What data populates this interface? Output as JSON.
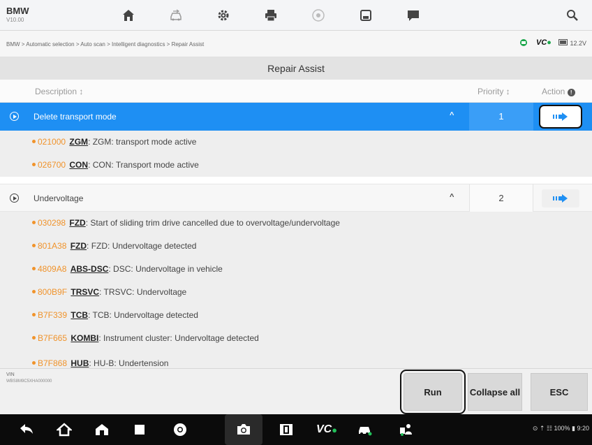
{
  "app": {
    "make": "BMW",
    "version": "V10.00"
  },
  "breadcrumb": "BMW > Automatic selection > Auto scan > Intelligent diagnostics > Repair Assist",
  "status": {
    "vc_label": "VC",
    "battery": "12.2V"
  },
  "title": "Repair Assist",
  "table": {
    "columns": {
      "description": "Description ↕",
      "priority": "Priority ↕",
      "action": "Action"
    }
  },
  "groups": [
    {
      "name": "Delete transport mode",
      "priority": "1",
      "selected": true,
      "faults": [
        {
          "code": "021000",
          "module": "ZGM",
          "text": ": ZGM: transport mode active"
        },
        {
          "code": "026700",
          "module": "CON",
          "text": ": CON: Transport mode active"
        }
      ]
    },
    {
      "name": "Undervoltage",
      "priority": "2",
      "selected": false,
      "faults": [
        {
          "code": "030298",
          "module": "FZD",
          "text": ": Start of sliding trim drive cancelled due to overvoltage/undervoltage"
        },
        {
          "code": "801A38",
          "module": "FZD",
          "text": ": FZD: Undervoltage detected"
        },
        {
          "code": "4809A8",
          "module": "ABS-DSC",
          "text": ": DSC: Undervoltage in vehicle"
        },
        {
          "code": "800B9F",
          "module": "TRSVC",
          "text": ": TRSVC: Undervoltage"
        },
        {
          "code": "B7F339",
          "module": "TCB",
          "text": ": TCB: Undervoltage detected"
        },
        {
          "code": "B7F665",
          "module": "KOMBI",
          "text": ": Instrument cluster: Undervoltage detected"
        },
        {
          "code": "B7F868",
          "module": "HUB",
          "text": ": HU-B: Undertension"
        }
      ]
    }
  ],
  "footer": {
    "vin_label": "VIN",
    "vin_value": "WBS8M9C5XHA000000",
    "run": "Run",
    "collapse": "Collapse all",
    "esc": "ESC"
  },
  "navbar": {
    "vc_label": "VC",
    "system_status": "⊙ ⇡ ☷ 100% ▮ 9:20"
  },
  "colors": {
    "accent": "#1e8ff3",
    "code": "#f0932b",
    "vc_green": "#1aa64a"
  }
}
